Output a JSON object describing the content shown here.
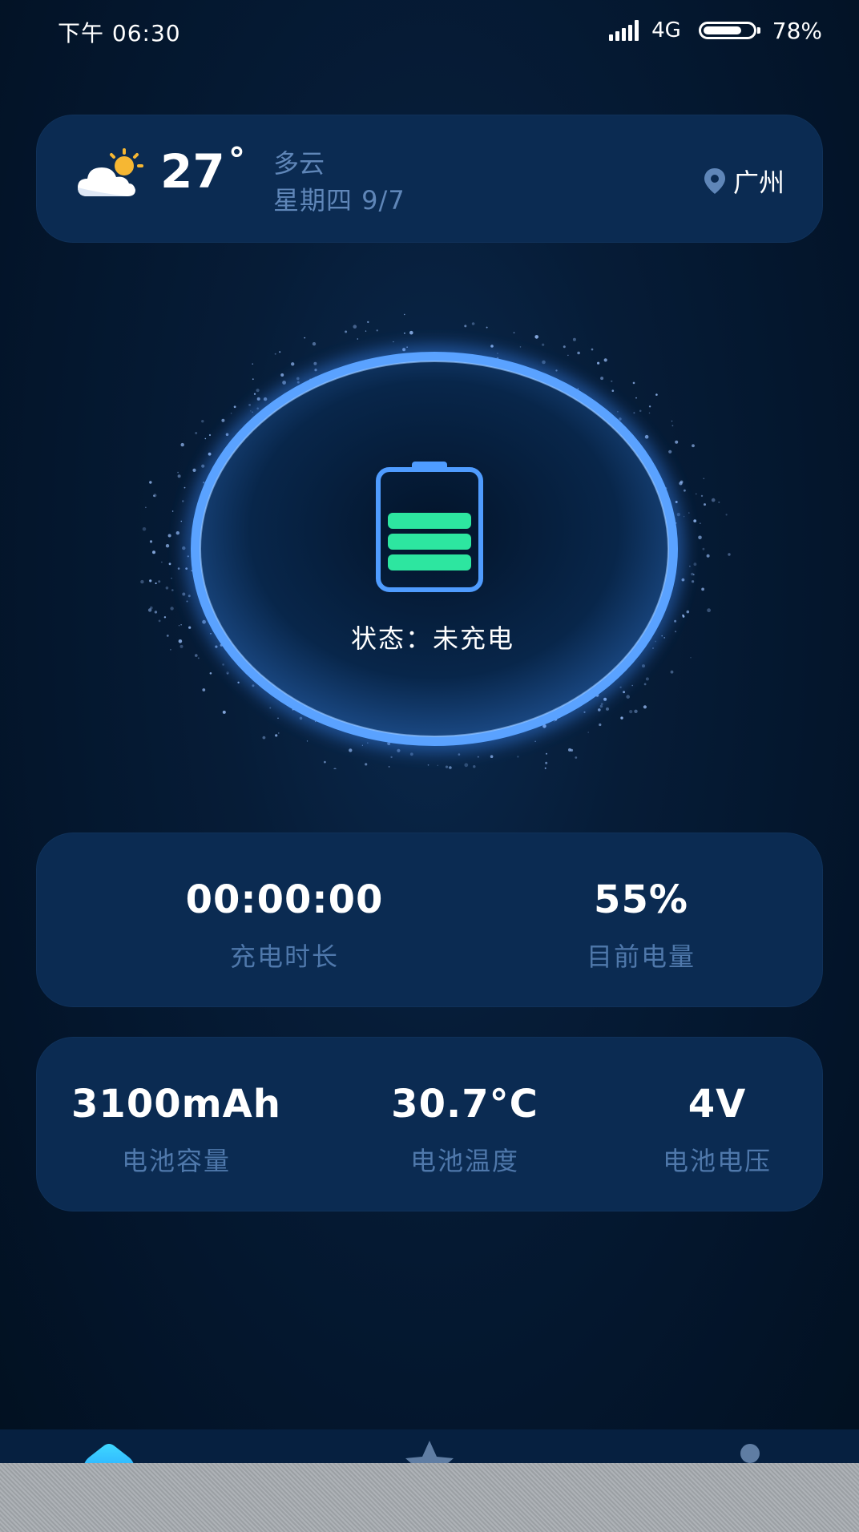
{
  "status_bar": {
    "time": "下午 06:30",
    "network": "4G",
    "battery_percent_text": "78%",
    "battery_level": 0.78
  },
  "weather": {
    "icon": "partly-cloudy-icon",
    "temperature": "27",
    "degree_symbol": "°",
    "condition": "多云",
    "date": "星期四 9/7",
    "location": "广州",
    "location_icon": "location-pin-icon"
  },
  "charger": {
    "status_text": "状态：未充电",
    "battery_icon": "battery-icon",
    "bars_filled": 3
  },
  "charge_stats": {
    "duration_value": "00:00:00",
    "duration_label": "充电时长",
    "level_value": "55%",
    "level_label": "目前电量"
  },
  "battery_info": {
    "capacity_value": "3100mAh",
    "capacity_label": "电池容量",
    "temperature_value": "30.7°C",
    "temperature_label": "电池温度",
    "voltage_value": "4V",
    "voltage_label": "电池电压"
  },
  "bottom_nav": {
    "items": [
      {
        "icon": "home-icon"
      },
      {
        "icon": "star-icon"
      },
      {
        "icon": "profile-icon"
      }
    ]
  },
  "colors": {
    "background": "#04172f",
    "card": "#0b2b52",
    "ring_blue": "#3d8cff",
    "battery_green": "#2de6a0",
    "muted_text": "#4f78ab"
  }
}
